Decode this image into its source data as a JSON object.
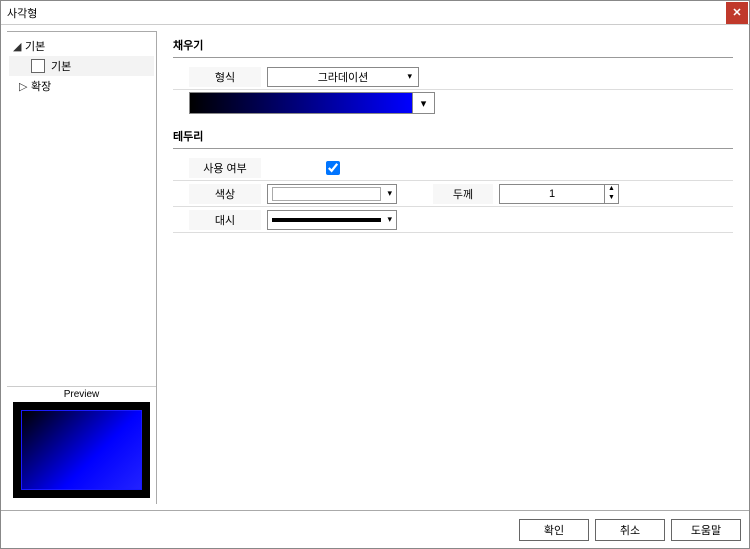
{
  "title": "사각형",
  "sidebar": {
    "items": [
      {
        "label": "기본",
        "expanded": true
      },
      {
        "label": "기본",
        "selected": true
      },
      {
        "label": "확장",
        "expanded": false
      }
    ],
    "preview_label": "Preview"
  },
  "fill": {
    "section_title": "채우기",
    "type_label": "형식",
    "type_value": "그라데이션"
  },
  "border": {
    "section_title": "테두리",
    "use_label": "사용 여부",
    "use_checked": true,
    "color_label": "색상",
    "color_value": "#ffffff",
    "thickness_label": "두께",
    "thickness_value": "1",
    "dash_label": "대시"
  },
  "buttons": {
    "ok": "확인",
    "cancel": "취소",
    "help": "도움말"
  }
}
